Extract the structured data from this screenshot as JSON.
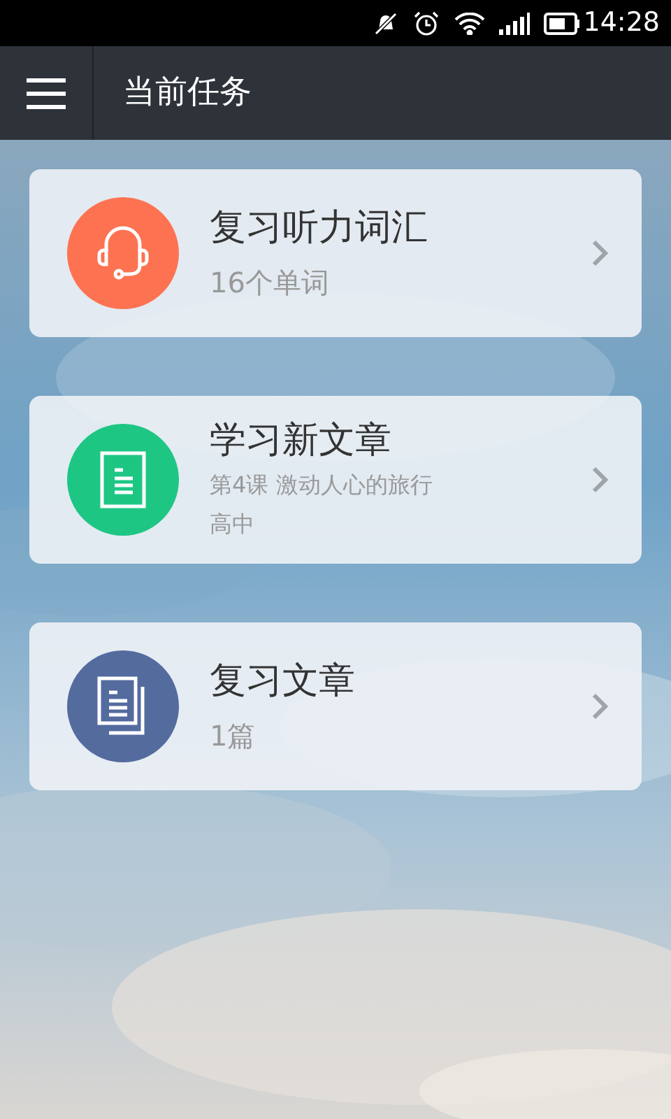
{
  "status_bar": {
    "time": "14:28"
  },
  "header": {
    "title": "当前任务"
  },
  "tasks": [
    {
      "kind": "headset",
      "color": "#fd7352",
      "title": "复习听力词汇",
      "subtitles": [
        "16个单词"
      ]
    },
    {
      "kind": "document",
      "color": "#1ec684",
      "title": "学习新文章",
      "subtitles": [
        "第4课 激动人心的旅行",
        "高中"
      ]
    },
    {
      "kind": "documents",
      "color": "#546b9e",
      "title": "复习文章",
      "subtitles": [
        "1篇"
      ]
    }
  ]
}
